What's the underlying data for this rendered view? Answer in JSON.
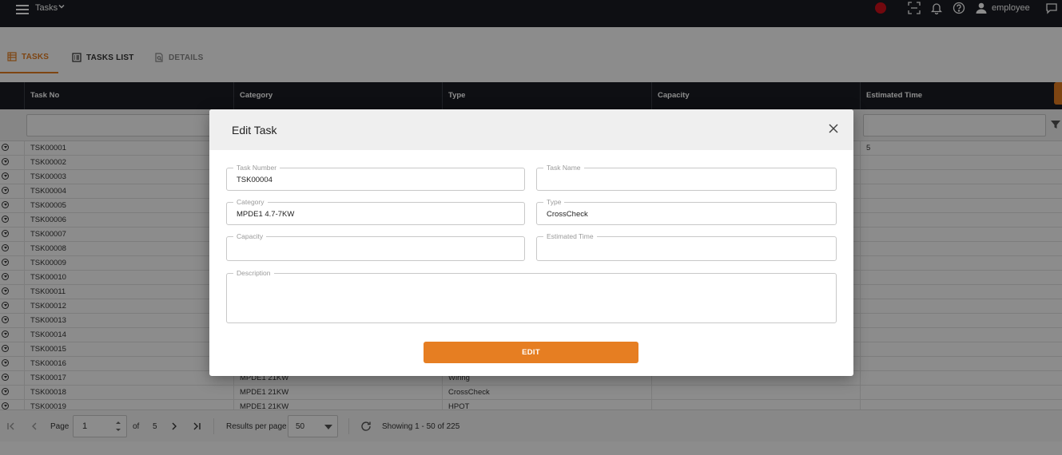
{
  "topbar": {
    "app_title": "Tasks",
    "user_name": "employee"
  },
  "tabs": [
    {
      "label": "TASKS"
    },
    {
      "label": "TASKS LIST"
    },
    {
      "label": "DETAILS"
    }
  ],
  "grid": {
    "columns": [
      "Task No",
      "Category",
      "Type",
      "Capacity",
      "Estimated Time"
    ],
    "first_row_estimated_time": "5",
    "rows": [
      {
        "task_no": "TSK00001",
        "category": "",
        "type": ""
      },
      {
        "task_no": "TSK00002",
        "category": "",
        "type": ""
      },
      {
        "task_no": "TSK00003",
        "category": "",
        "type": ""
      },
      {
        "task_no": "TSK00004",
        "category": "",
        "type": ""
      },
      {
        "task_no": "TSK00005",
        "category": "",
        "type": ""
      },
      {
        "task_no": "TSK00006",
        "category": "",
        "type": ""
      },
      {
        "task_no": "TSK00007",
        "category": "",
        "type": ""
      },
      {
        "task_no": "TSK00008",
        "category": "",
        "type": ""
      },
      {
        "task_no": "TSK00009",
        "category": "",
        "type": ""
      },
      {
        "task_no": "TSK00010",
        "category": "",
        "type": ""
      },
      {
        "task_no": "TSK00011",
        "category": "",
        "type": ""
      },
      {
        "task_no": "TSK00012",
        "category": "",
        "type": ""
      },
      {
        "task_no": "TSK00013",
        "category": "",
        "type": ""
      },
      {
        "task_no": "TSK00014",
        "category": "",
        "type": ""
      },
      {
        "task_no": "TSK00015",
        "category": "",
        "type": ""
      },
      {
        "task_no": "TSK00016",
        "category": "",
        "type": ""
      },
      {
        "task_no": "TSK00017",
        "category": "MPDE1 21KW",
        "type": "Wiring"
      },
      {
        "task_no": "TSK00018",
        "category": "MPDE1 21KW",
        "type": "CrossCheck"
      },
      {
        "task_no": "TSK00019",
        "category": "MPDE1 21KW",
        "type": "HPOT"
      }
    ]
  },
  "pager": {
    "page_label": "Page",
    "page_value": "1",
    "of_label": "of",
    "total_pages": "5",
    "results_per_page_label": "Results per page",
    "results_per_page_value": "50",
    "showing_text": "Showing 1 - 50 of 225"
  },
  "modal": {
    "title": "Edit Task",
    "fields": {
      "task_number": {
        "label": "Task Number",
        "value": "TSK00004"
      },
      "task_name": {
        "label": "Task Name",
        "value": ""
      },
      "category": {
        "label": "Category",
        "value": "MPDE1 4.7-7KW"
      },
      "type": {
        "label": "Type",
        "value": "CrossCheck"
      },
      "capacity": {
        "label": "Capacity",
        "value": ""
      },
      "estimated_time": {
        "label": "Estimated Time",
        "value": ""
      },
      "description": {
        "label": "Description",
        "value": ""
      }
    },
    "submit_label": "EDIT"
  },
  "colors": {
    "accent": "#e67e22",
    "header_bg": "#1a1d23",
    "record": "#d0101b"
  },
  "icons": [
    "menu-icon",
    "chevron-down-icon",
    "record-icon",
    "scan-icon",
    "bell-icon",
    "help-icon",
    "user-icon",
    "chat-icon",
    "table-icon",
    "list-icon",
    "document-search-icon",
    "filter-icon",
    "expand-row-icon",
    "first-page-icon",
    "prev-page-icon",
    "next-page-icon",
    "last-page-icon",
    "refresh-icon",
    "close-icon"
  ]
}
